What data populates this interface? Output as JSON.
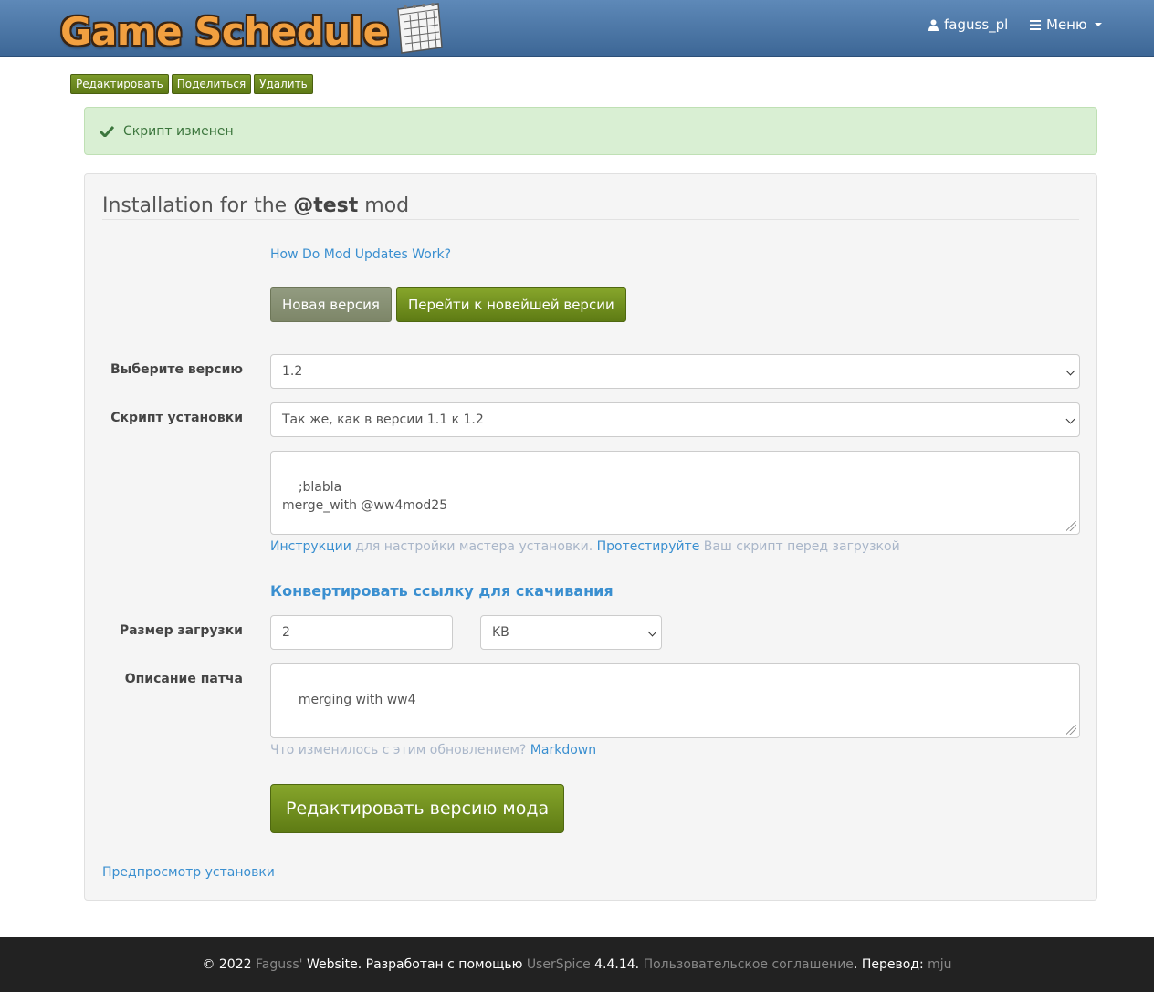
{
  "header": {
    "logo_text": "Game Schedule",
    "username": "faguss_pl",
    "menu_label": "Меню"
  },
  "actions": {
    "edit": "Редактировать",
    "share": "Поделиться",
    "delete": "Удалить"
  },
  "alert": {
    "message": "Скрипт изменен"
  },
  "panel": {
    "title_prefix": "Installation for the",
    "title_mod": "@test",
    "title_suffix": "mod",
    "mod_updates_link": "How Do Mod Updates Work?",
    "new_version_button": "Новая версия",
    "latest_version_button": "Перейти к новейшей версии",
    "version_label": "Выберите версию",
    "version_value": "1.2",
    "script_label": "Скрипт установки",
    "script_select_value": "Так же, как в версии 1.1 к 1.2",
    "script_text": ";blabla\nmerge_with @ww4mod25",
    "script_help_link1": "Инструкции",
    "script_help_text1": " для настройки мастера установки. ",
    "script_help_link2": "Протестируйте",
    "script_help_text2": " Ваш скрипт перед загрузкой",
    "convert_link": "Конвертировать ссылку для скачивания",
    "size_label": "Размер загрузки",
    "size_value": "2",
    "size_unit": "KB",
    "patch_label": "Описание патча",
    "patch_text": "merging with ww4",
    "patch_help_text": "Что изменилось с этим обновлением? ",
    "patch_help_link": "Markdown",
    "submit_button": "Редактировать версию мода",
    "preview_link": "Предпросмотр установки"
  },
  "footer": {
    "copy": "© 2022 ",
    "owner_link": "Faguss'",
    "text1": " Website. Разработан с помощью ",
    "userspice_link": "UserSpice",
    "text2": " 4.4.14. ",
    "agreement_link": "Пользовательское соглашение",
    "text3": ". Перевод: ",
    "translator_link": "mju"
  }
}
